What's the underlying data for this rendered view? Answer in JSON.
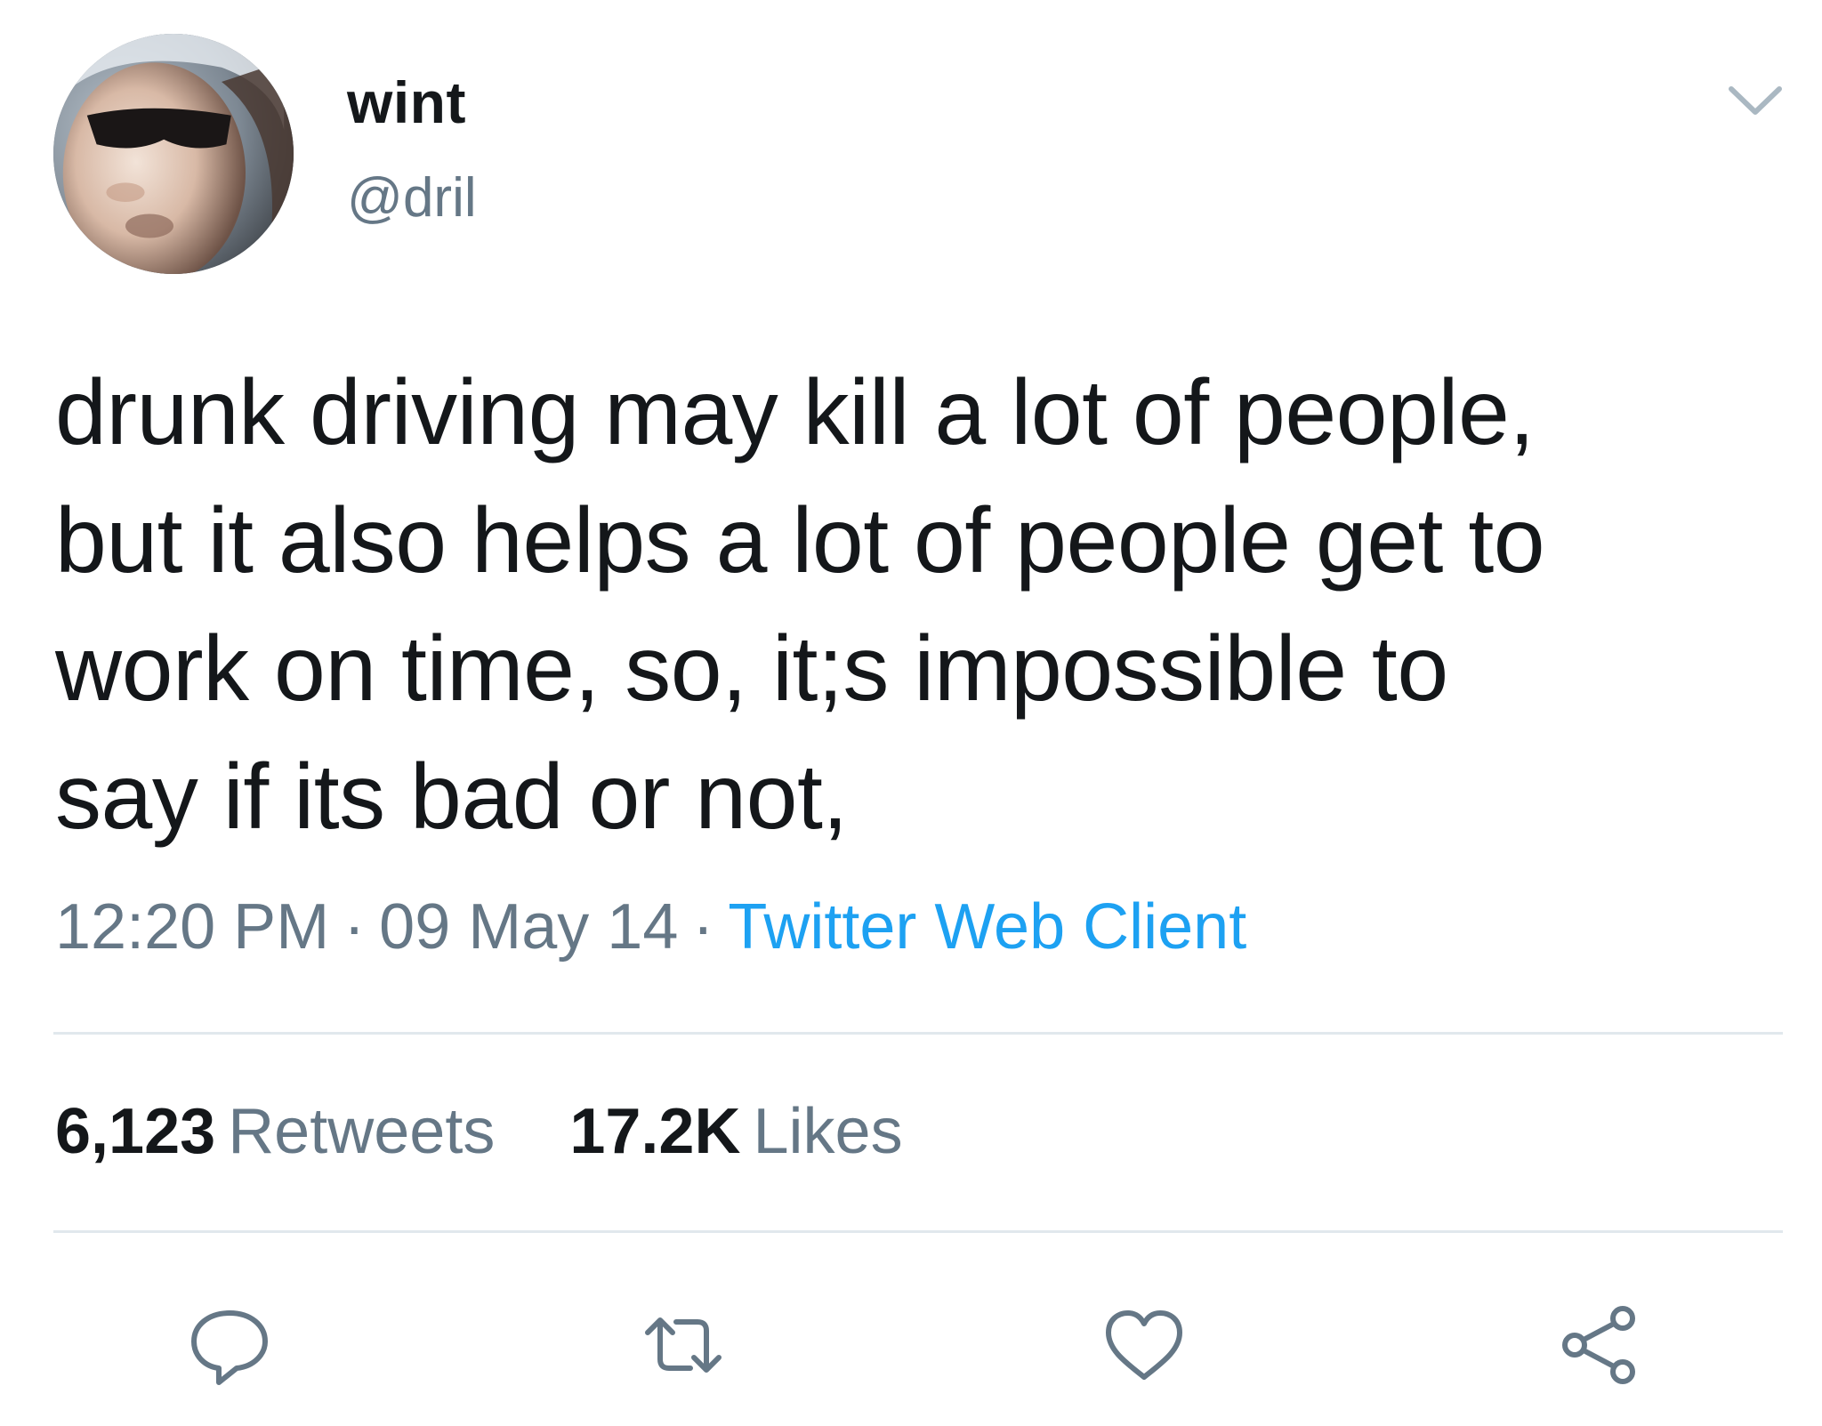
{
  "user": {
    "display_name": "wint",
    "handle": "@dril"
  },
  "tweet": {
    "text": "drunk driving may kill a lot of people,\nbut it also helps a lot of people get to\nwork on time, so, it;s impossible to\nsay if its bad or not,",
    "time": "12:20 PM",
    "date": "09 May 14",
    "separator": "·",
    "client": "Twitter Web Client"
  },
  "stats": {
    "retweets_count": "6,123",
    "retweets_label": "Retweets",
    "likes_count": "17.2K",
    "likes_label": "Likes"
  },
  "actions": [
    {
      "icon": "reply-icon"
    },
    {
      "icon": "retweet-icon"
    },
    {
      "icon": "like-icon"
    },
    {
      "icon": "share-icon"
    }
  ],
  "colors": {
    "text": "#14171a",
    "secondary": "#657786",
    "link": "#1da1f2",
    "divider": "#e1e8ed"
  }
}
